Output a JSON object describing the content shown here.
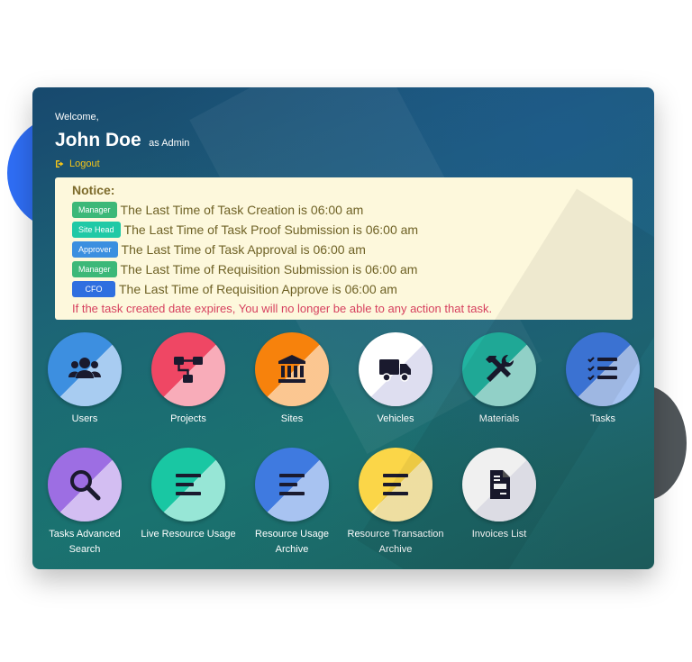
{
  "header": {
    "welcome": "Welcome,",
    "user_name": "John Doe",
    "user_role": "as Admin",
    "logout_label": "Logout"
  },
  "notice": {
    "title": "Notice:",
    "items": [
      {
        "badge": "Manager",
        "badge_color": "#3cb878",
        "text": "The Last Time of Task Creation is 06:00 am"
      },
      {
        "badge": "Site Head",
        "badge_color": "#20c9a6",
        "text": "The Last Time of Task Proof Submission is 06:00 am"
      },
      {
        "badge": "Approver",
        "badge_color": "#3b8fe0",
        "text": "The Last Time of Task Approval is 06:00 am"
      },
      {
        "badge": "Manager",
        "badge_color": "#3cb878",
        "text": "The Last Time of Requisition Submission is 06:00 am"
      },
      {
        "badge": "CFO",
        "badge_color": "#2f6fe0",
        "text": "The Last Time of Requisition Approve is 06:00 am"
      }
    ],
    "warning": "If the task created date expires, You will no longer be able to any action that task."
  },
  "tiles": [
    {
      "label": "Users",
      "icon": "users-icon",
      "color": "#3d8fe0"
    },
    {
      "label": "Projects",
      "icon": "sitemap-icon",
      "color": "#ef4764"
    },
    {
      "label": "Sites",
      "icon": "building-icon",
      "color": "#f7820c"
    },
    {
      "label": "Vehicles",
      "icon": "truck-icon",
      "color": "#ffffff"
    },
    {
      "label": "Materials",
      "icon": "tools-icon",
      "color": "#21b3a0"
    },
    {
      "label": "Tasks",
      "icon": "tasks-icon",
      "color": "#3f7ae0"
    },
    {
      "label": "Tasks Advanced Search",
      "icon": "search-icon",
      "color": "#9d6ee3"
    },
    {
      "label": "Live Resource Usage",
      "icon": "align-left-icon",
      "color": "#19c7a3"
    },
    {
      "label": "Resource Usage Archive",
      "icon": "align-left-icon",
      "color": "#3f7ae0"
    },
    {
      "label": "Resource Transaction Archive",
      "icon": "align-left-icon",
      "color": "#fbd648"
    },
    {
      "label": "Invoices List",
      "icon": "file-invoice-icon",
      "color": "#ffffff"
    }
  ]
}
